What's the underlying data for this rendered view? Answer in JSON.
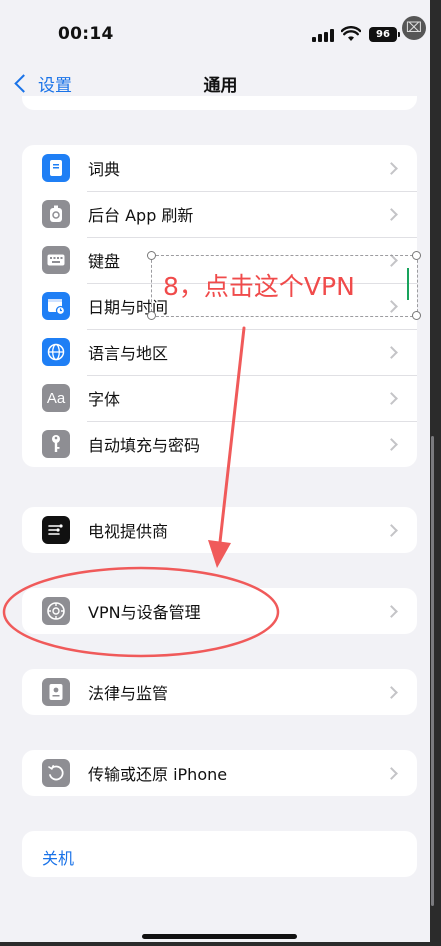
{
  "status": {
    "time": "00:14",
    "battery": "96",
    "close_glyph": "⌧"
  },
  "nav": {
    "back_label": "设置",
    "title": "通用"
  },
  "groups": {
    "g1": [
      {
        "label": "词典",
        "icon": "dictionary-icon",
        "color": "#1f7ff5"
      },
      {
        "label": "后台 App 刷新",
        "icon": "background-refresh-icon",
        "color": "#8e8e93"
      },
      {
        "label": "键盘",
        "icon": "keyboard-icon",
        "color": "#8e8e93"
      },
      {
        "label": "日期与时间",
        "icon": "calendar-clock-icon",
        "color": "#1f7ff5"
      },
      {
        "label": "语言与地区",
        "icon": "globe-icon",
        "color": "#1f7ff5"
      },
      {
        "label": "字体",
        "icon": "font-icon",
        "color": "#8e8e93",
        "glyph": "Aa"
      },
      {
        "label": "自动填充与密码",
        "icon": "key-icon",
        "color": "#8e8e93"
      }
    ],
    "g2": [
      {
        "label": "电视提供商",
        "icon": "tv-provider-icon",
        "color": "#111111"
      }
    ],
    "g3": [
      {
        "label": "VPN与设备管理",
        "icon": "gear-icon",
        "color": "#8e8e93"
      }
    ],
    "g4": [
      {
        "label": "法律与监管",
        "icon": "legal-icon",
        "color": "#8e8e93"
      }
    ],
    "g5": [
      {
        "label": "传输或还原 iPhone",
        "icon": "reset-icon",
        "color": "#8e8e93"
      }
    ],
    "shutdown": "关机"
  },
  "annotation": {
    "text": "8，点击这个VPN",
    "color": "#f04b4b"
  }
}
